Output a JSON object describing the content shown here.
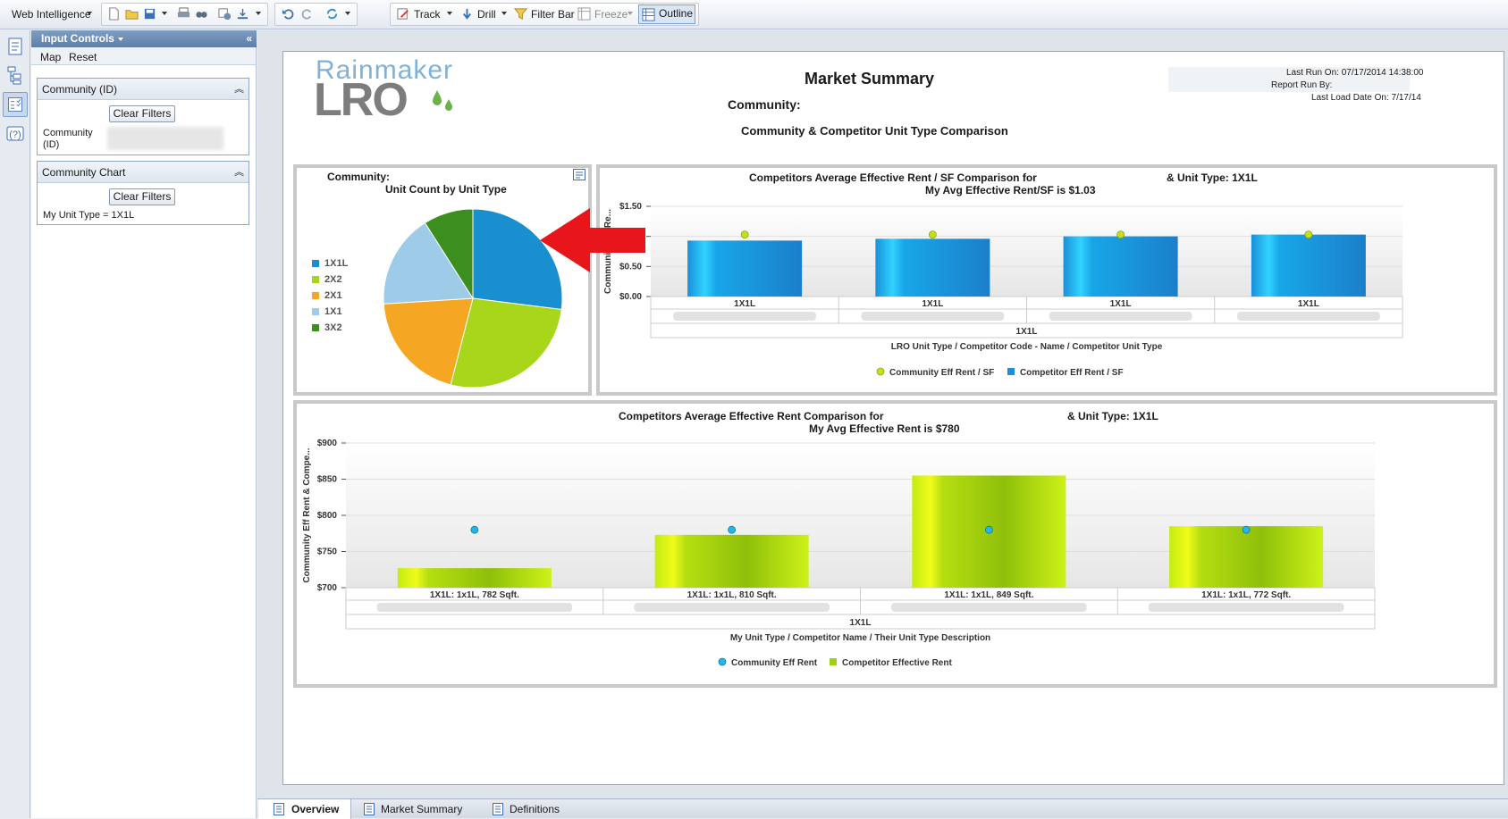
{
  "toolbar": {
    "app_menu": "Web Intelligence",
    "track": "Track",
    "drill": "Drill",
    "filter_bar": "Filter Bar",
    "freeze": "Freeze",
    "outline": "Outline"
  },
  "panel": {
    "title": "Input Controls",
    "map": "Map",
    "reset": "Reset",
    "box1": {
      "title": "Community (ID)",
      "clear": "Clear Filters",
      "field_label": "Community (ID)"
    },
    "box2": {
      "title": "Community Chart",
      "clear": "Clear Filters",
      "selection": "My Unit Type = 1X1L"
    }
  },
  "report": {
    "logo_top": "Rainmaker",
    "logo_bottom": "LRO",
    "title": "Market Summary",
    "community": "Community:",
    "subtitle": "Community & Competitor Unit Type Comparison",
    "last_run": "Last Run On: 07/17/2014 14:38:00",
    "run_by": "Report Run By:",
    "last_load": "Last Load Date On: 7/17/14"
  },
  "charts": {
    "pie": {
      "community": "Community:",
      "title": "Unit Count by Unit Type",
      "legend": [
        "1X1L",
        "2X2",
        "2X1",
        "1X1",
        "3X2"
      ],
      "colors": [
        "#1a8fd0",
        "#a8d61a",
        "#f5a623",
        "#9dcbe8",
        "#3b8f1e"
      ]
    },
    "rent_sf": {
      "title": "Competitors Average Effective Rent / SF Comparison for",
      "unit_type": "& Unit Type: 1X1L",
      "subtitle": "My Avg Effective Rent/SF is $1.03",
      "ylabel": "Community Eff Re...",
      "xlabel": "LRO Unit Type / Competitor Code - Name / Competitor Unit Type",
      "group_label": "1X1L",
      "legend": [
        "Community Eff Rent / SF",
        "Competitor Eff Rent / SF"
      ]
    },
    "rent": {
      "title": "Competitors Average Effective Rent Comparison for",
      "unit_type": "& Unit Type: 1X1L",
      "subtitle": "My Avg Effective Rent is $780",
      "ylabel": "Community Eff Rent & Compe...",
      "xlabel": "My Unit Type / Competitor Name / Their Unit Type Description",
      "group_label": "1X1L",
      "legend": [
        "Community Eff Rent",
        "Competitor Effective Rent"
      ]
    }
  },
  "chart_data": [
    {
      "type": "pie",
      "title": "Unit Count by Unit Type",
      "categories": [
        "1X1L",
        "2X2",
        "2X1",
        "1X1",
        "3X2"
      ],
      "values": [
        27,
        27,
        20,
        17,
        9
      ]
    },
    {
      "type": "bar",
      "title": "Competitors Average Effective Rent / SF Comparison for",
      "categories": [
        "1X1L",
        "1X1L",
        "1X1L",
        "1X1L"
      ],
      "series": [
        {
          "name": "Competitor Eff Rent / SF",
          "values": [
            0.93,
            0.96,
            1.0,
            1.03
          ]
        },
        {
          "name": "Community Eff Rent / SF",
          "values": [
            1.03,
            1.03,
            1.03,
            1.03
          ]
        }
      ],
      "ylim": [
        0,
        1.5
      ],
      "yticks": [
        "$0.00",
        "$0.50",
        "$1.00",
        "$1.50"
      ],
      "xlabel": "LRO Unit Type / Competitor Code - Name / Competitor Unit Type"
    },
    {
      "type": "bar",
      "title": "Competitors Average Effective Rent Comparison for",
      "categories": [
        "1X1L: 1x1L, 782 Sqft.",
        "1X1L: 1x1L, 810 Sqft.",
        "1X1L: 1x1L, 849 Sqft.",
        "1X1L: 1x1L, 772 Sqft."
      ],
      "series": [
        {
          "name": "Competitor Effective Rent",
          "values": [
            727,
            773,
            855,
            785
          ]
        },
        {
          "name": "Community Eff Rent",
          "values": [
            780,
            780,
            780,
            780
          ]
        }
      ],
      "ylim": [
        700,
        900
      ],
      "yticks": [
        "$700",
        "$750",
        "$800",
        "$850",
        "$900"
      ],
      "xlabel": "My Unit Type / Competitor Name / Their Unit Type Description"
    }
  ],
  "tabs": [
    "Overview",
    "Market Summary",
    "Definitions"
  ]
}
